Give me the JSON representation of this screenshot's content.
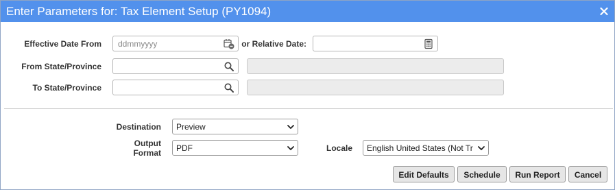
{
  "window": {
    "title": "Enter Parameters for: Tax Element Setup (PY1094)",
    "close_icon": "close-icon"
  },
  "params": {
    "effective_date_from": {
      "label": "Effective Date From",
      "value": "",
      "placeholder": "ddmmyyyy",
      "icon": "calendar-clear-icon"
    },
    "relative_date": {
      "label": "or Relative Date:",
      "value": "",
      "icon": "calculator-icon"
    },
    "from_state": {
      "label": "From State/Province",
      "value": "",
      "description": "",
      "icon": "search-icon"
    },
    "to_state": {
      "label": "To State/Province",
      "value": "",
      "description": "",
      "icon": "search-icon"
    }
  },
  "output": {
    "destination": {
      "label": "Destination",
      "value": "Preview"
    },
    "output_format": {
      "label_line1": "Output",
      "label_line2": "Format",
      "value": "PDF"
    },
    "locale": {
      "label": "Locale",
      "value": "English United States (Not Tr"
    }
  },
  "buttons": {
    "edit_defaults": "Edit Defaults",
    "schedule": "Schedule",
    "run_report": "Run Report",
    "cancel": "Cancel"
  },
  "colors": {
    "titlebar": "#5291ec",
    "button_bg": "#e6e6e6",
    "readonly_bg": "#ececec"
  }
}
